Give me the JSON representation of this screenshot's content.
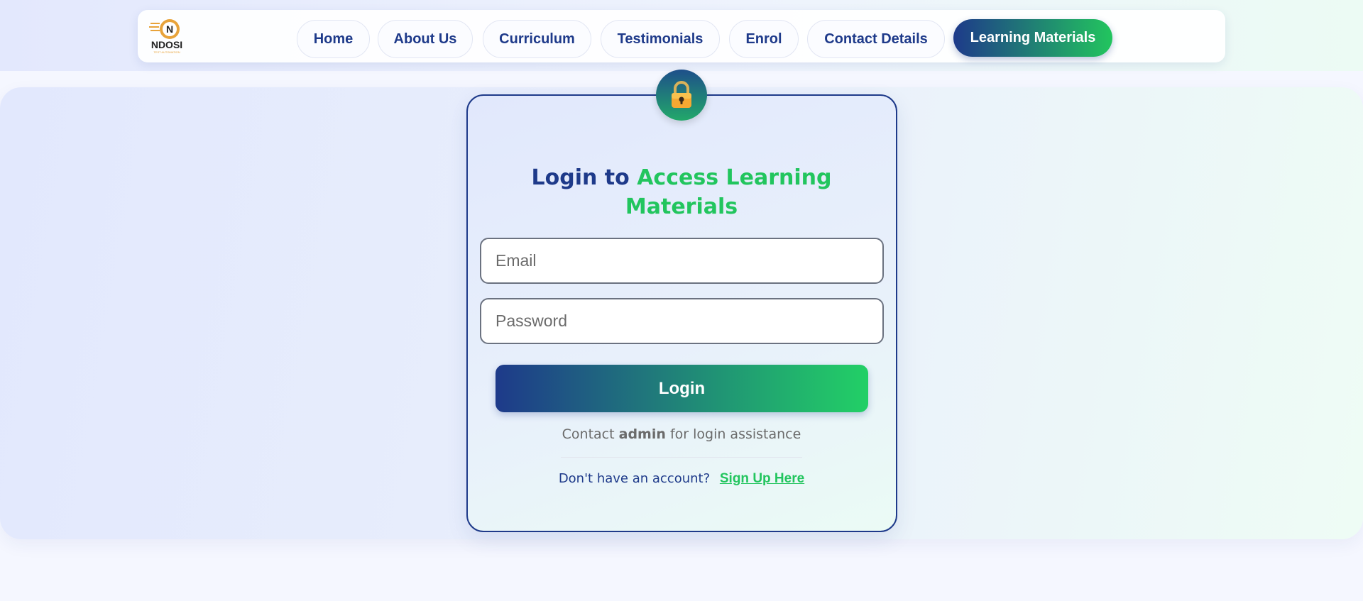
{
  "brand": {
    "logo_letter": "N",
    "logo_name": "NDOSI",
    "logo_tagline": "TEST AUTOMATION"
  },
  "nav": {
    "items": [
      {
        "label": "Home"
      },
      {
        "label": "About Us"
      },
      {
        "label": "Curriculum"
      },
      {
        "label": "Testimonials"
      },
      {
        "label": "Enrol"
      },
      {
        "label": "Contact Details"
      },
      {
        "label": "Learning Materials",
        "active": true
      }
    ]
  },
  "login": {
    "icon": "lock-icon",
    "title_part1": "Login to",
    "title_part2": "Access Learning Materials",
    "email_placeholder": "Email",
    "password_placeholder": "Password",
    "button_label": "Login",
    "contact_prefix": "Contact",
    "contact_bold": "admin",
    "contact_suffix": "for login assistance",
    "signup_prompt": "Don't have an account?",
    "signup_link": "Sign Up Here"
  },
  "colors": {
    "primary": "#1e3a8a",
    "accent": "#22c55e"
  }
}
